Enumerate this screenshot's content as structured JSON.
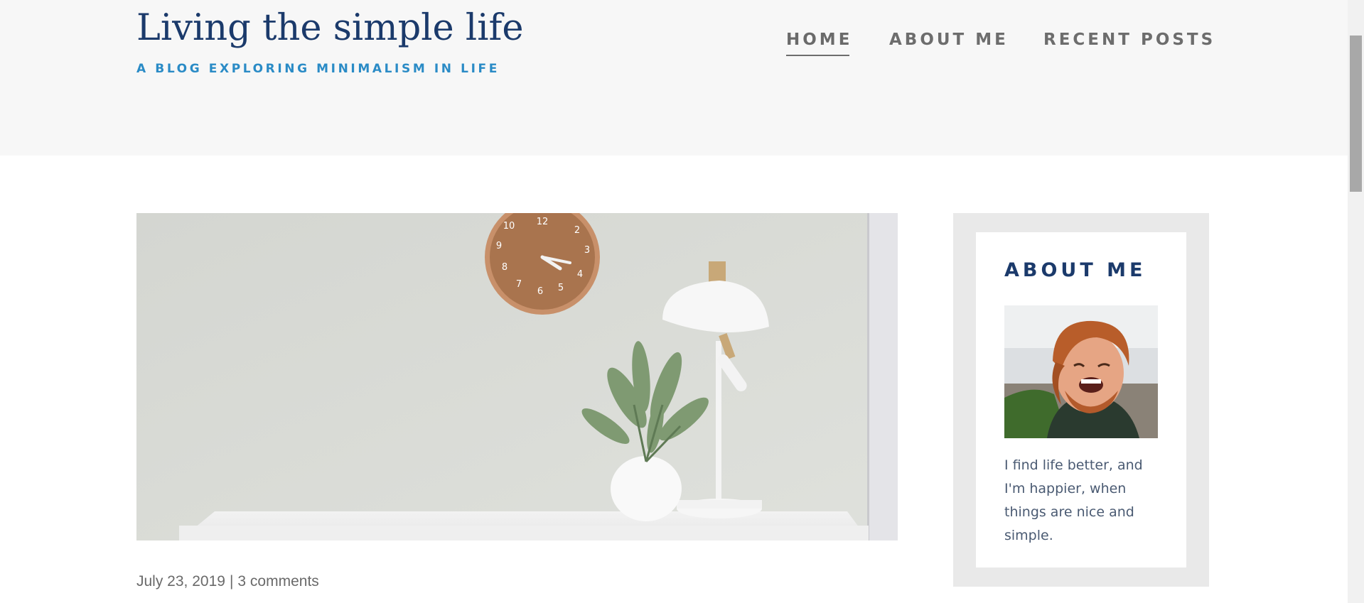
{
  "header": {
    "site_title": "Living the simple life",
    "tagline": "A BLOG EXPLORING MINIMALISM IN LIFE"
  },
  "nav": {
    "items": [
      {
        "label": "HOME",
        "active": true
      },
      {
        "label": "ABOUT ME",
        "active": false
      },
      {
        "label": "RECENT POSTS",
        "active": false
      }
    ]
  },
  "post": {
    "date": "July 23, 2019",
    "separator": "|",
    "comments": "3 comments"
  },
  "sidebar": {
    "widget_title": "ABOUT ME",
    "bio": "I find life better, and I'm happier, when things are nice and simple."
  },
  "colors": {
    "title": "#1b3a6b",
    "tagline": "#2a8bc6",
    "nav": "#6d6d6d",
    "header_bg": "#f7f7f7",
    "sidebar_bg": "#e9e9e9"
  }
}
